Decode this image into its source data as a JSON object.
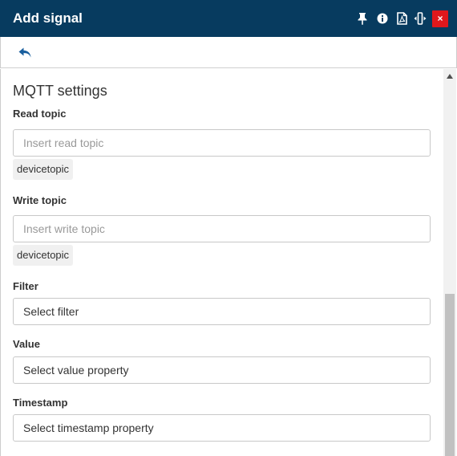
{
  "window": {
    "title": "Add signal",
    "icons": [
      "pin-icon",
      "info-icon",
      "pdf-icon",
      "resize-icon",
      "close-icon"
    ],
    "close_glyph": "×",
    "accent": "#073b5f",
    "close_color": "#e0181c"
  },
  "toolbar": {
    "back_icon": "reply-arrow-icon"
  },
  "section": {
    "title": "MQTT settings"
  },
  "fields": {
    "read_topic": {
      "label": "Read topic",
      "placeholder": "Insert read topic",
      "value": "",
      "suggestion": "devicetopic"
    },
    "write_topic": {
      "label": "Write topic",
      "placeholder": "Insert write topic",
      "value": "",
      "suggestion": "devicetopic"
    },
    "filter": {
      "label": "Filter",
      "value": "Select filter"
    },
    "value": {
      "label": "Value",
      "value": "Select value property"
    },
    "timestamp": {
      "label": "Timestamp",
      "value": "Select timestamp property"
    }
  }
}
